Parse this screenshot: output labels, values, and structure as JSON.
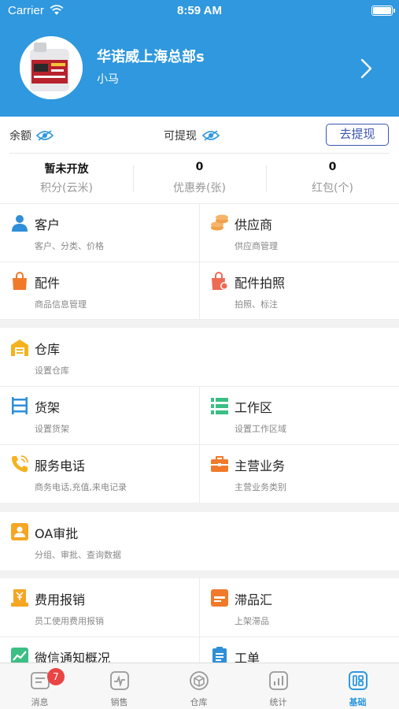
{
  "status_bar": {
    "carrier": "Carrier",
    "time": "8:59 AM"
  },
  "profile": {
    "name": "华诺威上海总部s",
    "subtitle": "小马"
  },
  "balance": {
    "balance_label": "余额",
    "withdrawable_label": "可提现",
    "withdraw_button": "去提现",
    "stats": [
      {
        "value": "暂未开放",
        "label": "积分(云米)"
      },
      {
        "value": "0",
        "label": "优惠券(张)"
      },
      {
        "value": "0",
        "label": "红包(个)"
      }
    ]
  },
  "menu": [
    {
      "title": "客户",
      "desc": "客户、分类、价格",
      "icon": "person-icon",
      "color": "#2f8fd8"
    },
    {
      "title": "供应商",
      "desc": "供应商管理",
      "icon": "coins-icon",
      "color": "#f2a04b"
    },
    {
      "title": "配件",
      "desc": "商品信息管理",
      "icon": "shopping-bag-icon",
      "color": "#f07a2a"
    },
    {
      "title": "配件拍照",
      "desc": "拍照、标注",
      "icon": "photo-bag-icon",
      "color": "#ef6a55"
    },
    {
      "title": "仓库",
      "desc": "设置仓库",
      "icon": "warehouse-icon",
      "color": "#f5b21d"
    },
    {
      "title": "货架",
      "desc": "设置货架",
      "icon": "shelf-icon",
      "color": "#2f8fd8"
    },
    {
      "title": "工作区",
      "desc": "设置工作区域",
      "icon": "work-area-icon",
      "color": "#3bbf84"
    },
    {
      "title": "服务电话",
      "desc": "商务电话,充值,来电记录",
      "icon": "phone-icon",
      "color": "#f5b21d"
    },
    {
      "title": "主营业务",
      "desc": "主营业务类别",
      "icon": "briefcase-icon",
      "color": "#f07a2a"
    },
    {
      "title": "OA审批",
      "desc": "分组、审批、查询数据",
      "icon": "approval-icon",
      "color": "#f5a623"
    },
    {
      "title": "费用报销",
      "desc": "员工使用费用报销",
      "icon": "expense-icon",
      "color": "#f5a623"
    },
    {
      "title": "滞品汇",
      "desc": "上架滞品",
      "icon": "stagnant-goods-icon",
      "color": "#f07a2a"
    },
    {
      "title": "微信通知概况",
      "desc": "",
      "icon": "trend-icon",
      "color": "#3bbf84"
    },
    {
      "title": "工单",
      "desc": "",
      "icon": "work-order-icon",
      "color": "#2f8fd8"
    }
  ],
  "tabs": [
    {
      "label": "消息",
      "icon": "message-icon",
      "badge": "7"
    },
    {
      "label": "销售",
      "icon": "sales-icon"
    },
    {
      "label": "仓库",
      "icon": "warehouse-box-icon"
    },
    {
      "label": "统计",
      "icon": "statistics-icon"
    },
    {
      "label": "基础",
      "icon": "basics-icon",
      "active": true
    }
  ],
  "colors": {
    "primary": "#2f98de",
    "button_outline": "#3c55b0",
    "badge": "#e94545"
  }
}
